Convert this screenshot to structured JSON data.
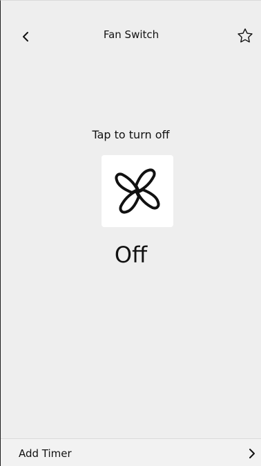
{
  "header": {
    "title": "Fan Switch",
    "back_icon": "chevron-left-icon",
    "favorite_icon": "star-outline-icon"
  },
  "device": {
    "hint": "Tap to turn off",
    "icon": "fan-icon",
    "state": "Off"
  },
  "footer": {
    "add_timer_label": "Add Timer",
    "chevron_icon": "chevron-right-icon"
  }
}
